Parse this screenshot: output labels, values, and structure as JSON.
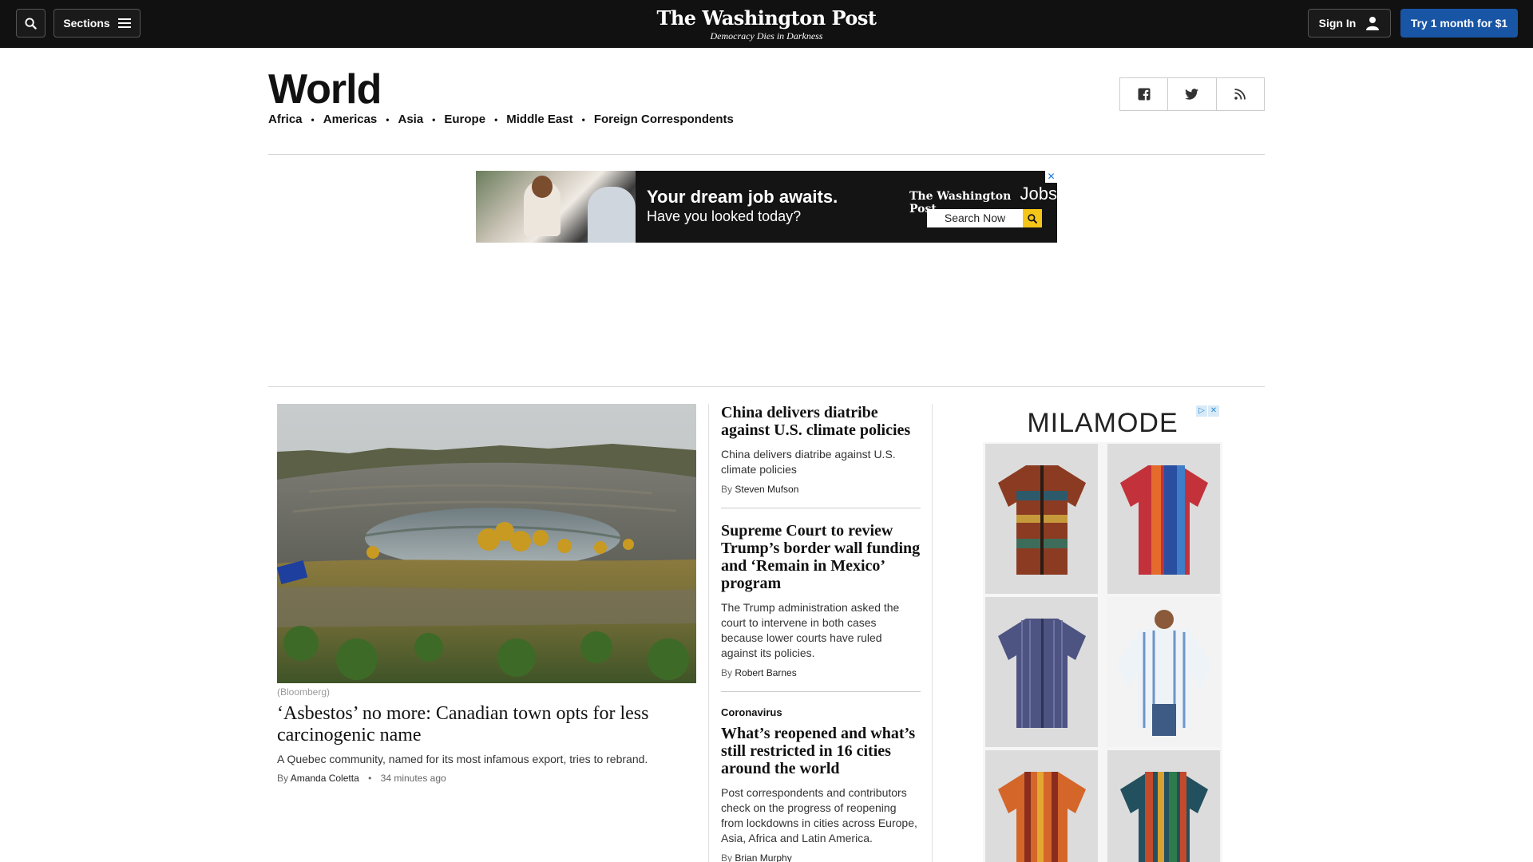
{
  "header": {
    "sections_label": "Sections",
    "logo": "The Washington Post",
    "tagline": "Democracy Dies in Darkness",
    "signin_label": "Sign In",
    "subscribe_label": "Try 1 month for $1"
  },
  "section": {
    "title": "World",
    "nav": [
      "Africa",
      "Americas",
      "Asia",
      "Europe",
      "Middle East",
      "Foreign Correspondents"
    ]
  },
  "share": {
    "icons": [
      "facebook-icon",
      "twitter-icon",
      "rss-icon"
    ]
  },
  "jobs_ad": {
    "headline": "Your dream job awaits.",
    "subline": "Have you looked today?",
    "brand": "The Washington Post",
    "brand_suffix": "Jobs",
    "search_label": "Search Now"
  },
  "lead": {
    "credit": "(Bloomberg)",
    "headline": "‘Asbestos’ no more: Canadian town opts for less carcinogenic name",
    "blurb": "A Quebec community, named for its most infamous export, tries to rebrand.",
    "by": "By",
    "author": "Amanda Coletta",
    "time": "34 minutes ago"
  },
  "stories": [
    {
      "headline": "China delivers diatribe against U.S. climate policies",
      "blurb": "China delivers diatribe against U.S. climate policies",
      "by": "By",
      "author": "Steven Mufson"
    },
    {
      "headline": "Supreme Court to review Trump’s border wall funding and ‘Remain in Mexico’ program",
      "blurb": "The Trump administration asked the court to intervene in both cases because lower courts have ruled against its policies.",
      "by": "By",
      "author": "Robert Barnes"
    },
    {
      "kicker": "Coronavirus",
      "headline": "What’s reopened and what’s still restricted in 16 cities around the world",
      "blurb": "Post correspondents and contributors check on the progress of reopening from lockdowns in cities across Europe, Asia, Africa and Latin America.",
      "by": "By",
      "author": "Brian Murphy"
    }
  ],
  "shirt_ad": {
    "brand": "MILAMODE"
  },
  "colors": {
    "topbar": "#111111",
    "subscribe": "#1955a5",
    "ad_accent": "#f5c518"
  }
}
